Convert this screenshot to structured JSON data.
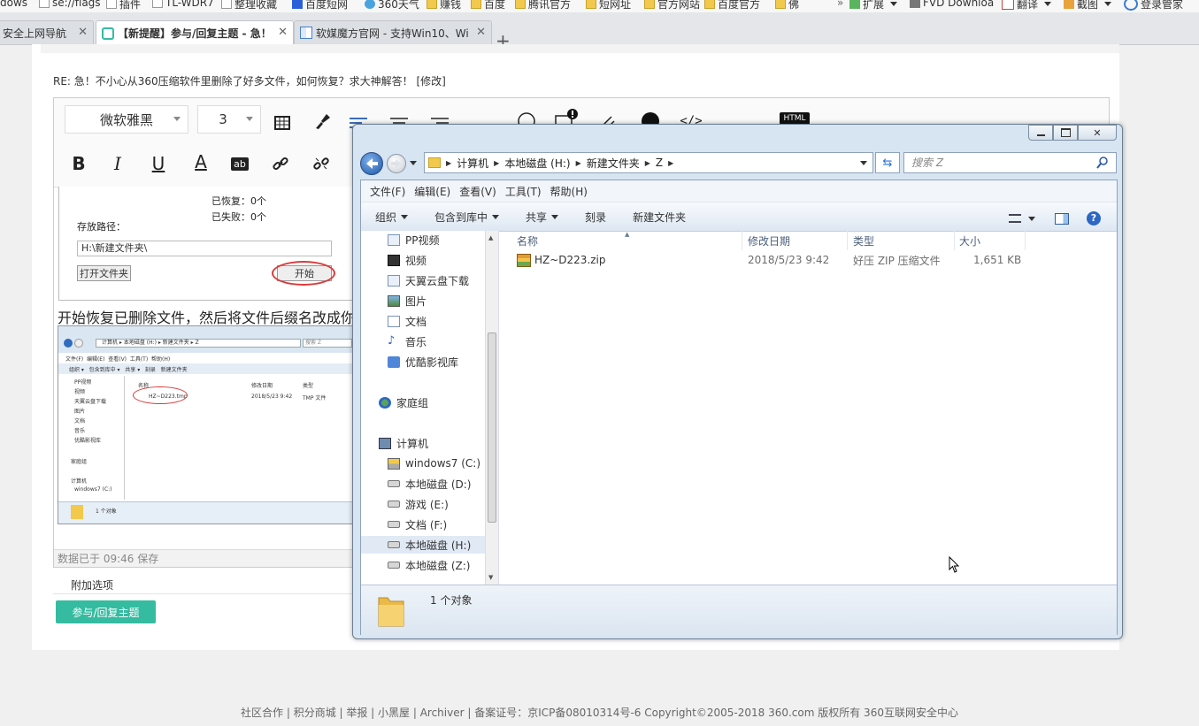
{
  "bookmarks": [
    {
      "label": "dows"
    },
    {
      "label": "se://flags"
    },
    {
      "label": "插件"
    },
    {
      "label": "TL-WDR7"
    },
    {
      "label": "整理收藏"
    },
    {
      "label": "百度短网"
    },
    {
      "label": "360天气"
    },
    {
      "label": "赚钱"
    },
    {
      "label": "百度"
    },
    {
      "label": "腾讯官方"
    },
    {
      "label": "短网址"
    },
    {
      "label": "官方网站"
    },
    {
      "label": "百度官方"
    },
    {
      "label": "佛"
    },
    {
      "label": "扩展"
    },
    {
      "label": "FVD Downloa"
    },
    {
      "label": "翻译"
    },
    {
      "label": "截图"
    },
    {
      "label": "登录管家"
    }
  ],
  "tabs": [
    {
      "label": "安全上网导航"
    },
    {
      "label": "【新提醒】参与/回复主题 - 急！"
    },
    {
      "label": "软媒魔方官网 - 支持Win10、Wi"
    }
  ],
  "page": {
    "re_title": "RE: 急！不小心从360压缩软件里删除了好多文件，如何恢复？求大神解答！ [修改]",
    "editor": {
      "font_name": "微软雅黑",
      "font_size": "3",
      "html_label": "HTML"
    },
    "snippet": {
      "recovered": "已恢复：0个",
      "failed": "已失败：0个",
      "save_path_label": "存放路径：",
      "save_path_value": "H:\\新建文件夹\\",
      "open_folder_btn": "打开文件夹",
      "start_btn": "开始"
    },
    "description": "开始恢复已删除文件，然后将文件后缀名改成你",
    "thumb": {
      "address": "计算机 ▸ 本地磁盘 (H:) ▸ 新建文件夹 ▸ Z",
      "search": "搜索 Z",
      "menu": "文件(F)  编辑(E)  查看(V)  工具(T)  帮助(H)",
      "cmds": "组织 ▾   包含到库中 ▾   共享 ▾   刻录   新建文件夹",
      "nav": [
        "PP视频",
        "视频",
        "天翼云盘下载",
        "图片",
        "文档",
        "音乐",
        "优酷影视库",
        "家庭组",
        "计算机",
        "windows7 (C:)"
      ],
      "col_name": "名称",
      "col_date": "修改日期",
      "col_type": "类型",
      "file_name": "HZ~D223.tmp",
      "file_date": "2018/5/23 9:42",
      "file_type": "TMP 文件",
      "status": "1 个对象"
    },
    "save_status": "数据已于 09:46 保存",
    "additional_options": "附加选项",
    "reply_button": "参与/回复主题"
  },
  "explorer": {
    "address": {
      "computer": "计算机",
      "disk": "本地磁盘 (H:)",
      "folder": "新建文件夹",
      "sub": "Z"
    },
    "search_placeholder": "搜索 Z",
    "menu": [
      "文件(F)",
      "编辑(E)",
      "查看(V)",
      "工具(T)",
      "帮助(H)"
    ],
    "commands": {
      "organize": "组织",
      "include_library": "包含到库中",
      "share": "共享",
      "burn": "刻录",
      "new_folder": "新建文件夹"
    },
    "nav_items": [
      {
        "label": "PP视频",
        "icon": "pp-video-icon"
      },
      {
        "label": "视频",
        "icon": "video-library-icon"
      },
      {
        "label": "天翼云盘下载",
        "icon": "cloud-download-icon"
      },
      {
        "label": "图片",
        "icon": "pictures-icon"
      },
      {
        "label": "文档",
        "icon": "documents-icon"
      },
      {
        "label": "音乐",
        "icon": "music-icon"
      },
      {
        "label": "优酷影视库",
        "icon": "youku-icon"
      },
      {
        "label": "家庭组",
        "icon": "homegroup-icon"
      },
      {
        "label": "计算机",
        "icon": "computer-icon"
      },
      {
        "label": "windows7 (C:)",
        "icon": "system-drive-icon"
      },
      {
        "label": "本地磁盘 (D:)",
        "icon": "drive-icon"
      },
      {
        "label": "游戏 (E:)",
        "icon": "drive-icon"
      },
      {
        "label": "文档 (F:)",
        "icon": "drive-icon"
      },
      {
        "label": "本地磁盘 (H:)",
        "icon": "drive-icon",
        "selected": true
      },
      {
        "label": "本地磁盘 (Z:)",
        "icon": "drive-icon"
      }
    ],
    "columns": {
      "name": "名称",
      "date": "修改日期",
      "type": "类型",
      "size": "大小"
    },
    "files": [
      {
        "name": "HZ~D223.zip",
        "date": "2018/5/23 9:42",
        "type": "好压 ZIP 压缩文件",
        "size": "1,651 KB"
      }
    ],
    "status_count": "1 个对象"
  },
  "footer": "社区合作 | 积分商城 | 举报 | 小黑屋 | Archiver |  备案证号：京ICP备08010314号-6  Copyright©2005-2018 360.com 版权所有 360互联网安全中心",
  "colors": {
    "reply_button": "#35bba0",
    "highlight_circle": "#d93b3b",
    "explorer_frame": "#d7e4f2"
  }
}
